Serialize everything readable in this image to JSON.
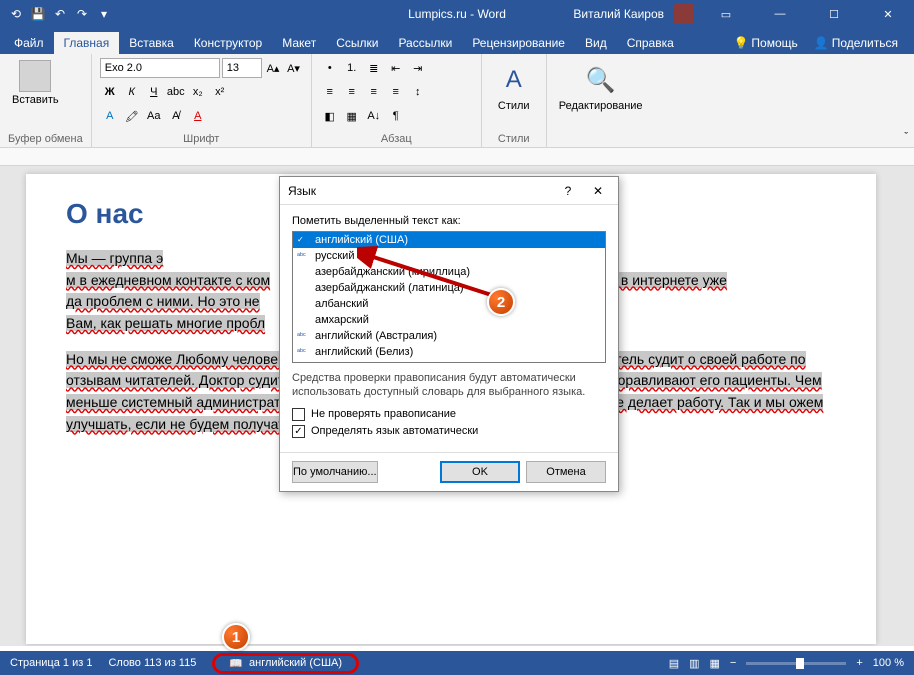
{
  "title": "Lumpics.ru - Word",
  "user": "Виталий Каиров",
  "tabs": {
    "file": "Файл",
    "home": "Главная",
    "insert": "Вставка",
    "design": "Конструктор",
    "layout": "Макет",
    "references": "Ссылки",
    "mailings": "Рассылки",
    "review": "Рецензирование",
    "view": "Вид",
    "help": "Справка",
    "tell_me": "Помощь",
    "share": "Поделиться"
  },
  "ribbon": {
    "clipboard": {
      "paste": "Вставить",
      "label": "Буфер обмена"
    },
    "font": {
      "name": "Exo 2.0",
      "size": "13",
      "label": "Шрифт"
    },
    "paragraph": {
      "label": "Абзац"
    },
    "styles": {
      "btn": "Стили",
      "label": "Стили"
    },
    "editing": {
      "btn": "Редактирование"
    }
  },
  "document": {
    "heading": "О нас",
    "p1_a": "Мы — группа э",
    "p1_b": "м в ежедневном контакте с ком",
    "p1_c": "Мы знаем, что в интернете уже",
    "p1_d": "да проблем с ними. Но это не",
    "p1_e": "Вам, как решать многие пробл",
    "p2": "Но мы не сможе                                                                           Любому человеку важно знать, что его действия правильные. Писатель судит о своей работе по отзывам читателей. Доктор судит о качестве своей работы по тому, как быстро выздоравливают его пациенты. Чем меньше системный администратор бегает и что-то настраивает, тем он качественнее делает работу. Так и мы            ожем улучшать, если не будем получать ответов от Вас."
  },
  "dialog": {
    "title": "Язык",
    "label": "Пометить выделенный текст как:",
    "langs": [
      "английский (США)",
      "русский",
      "азербайджанский (кириллица)",
      "азербайджанский (латиница)",
      "албанский",
      "амхарский",
      "английский (Австралия)",
      "английский (Белиз)"
    ],
    "info": "Средства проверки правописания будут автоматически использовать доступный словарь для выбранного языка.",
    "chk1": "Не проверять правописание",
    "chk2": "Определять язык автоматически",
    "default_btn": "По умолчанию...",
    "ok": "OK",
    "cancel": "Отмена"
  },
  "status": {
    "page": "Страница 1 из 1",
    "words": "Слово 113 из 115",
    "lang": "английский (США)",
    "zoom": "100 %"
  },
  "callouts": {
    "c1": "1",
    "c2": "2"
  }
}
